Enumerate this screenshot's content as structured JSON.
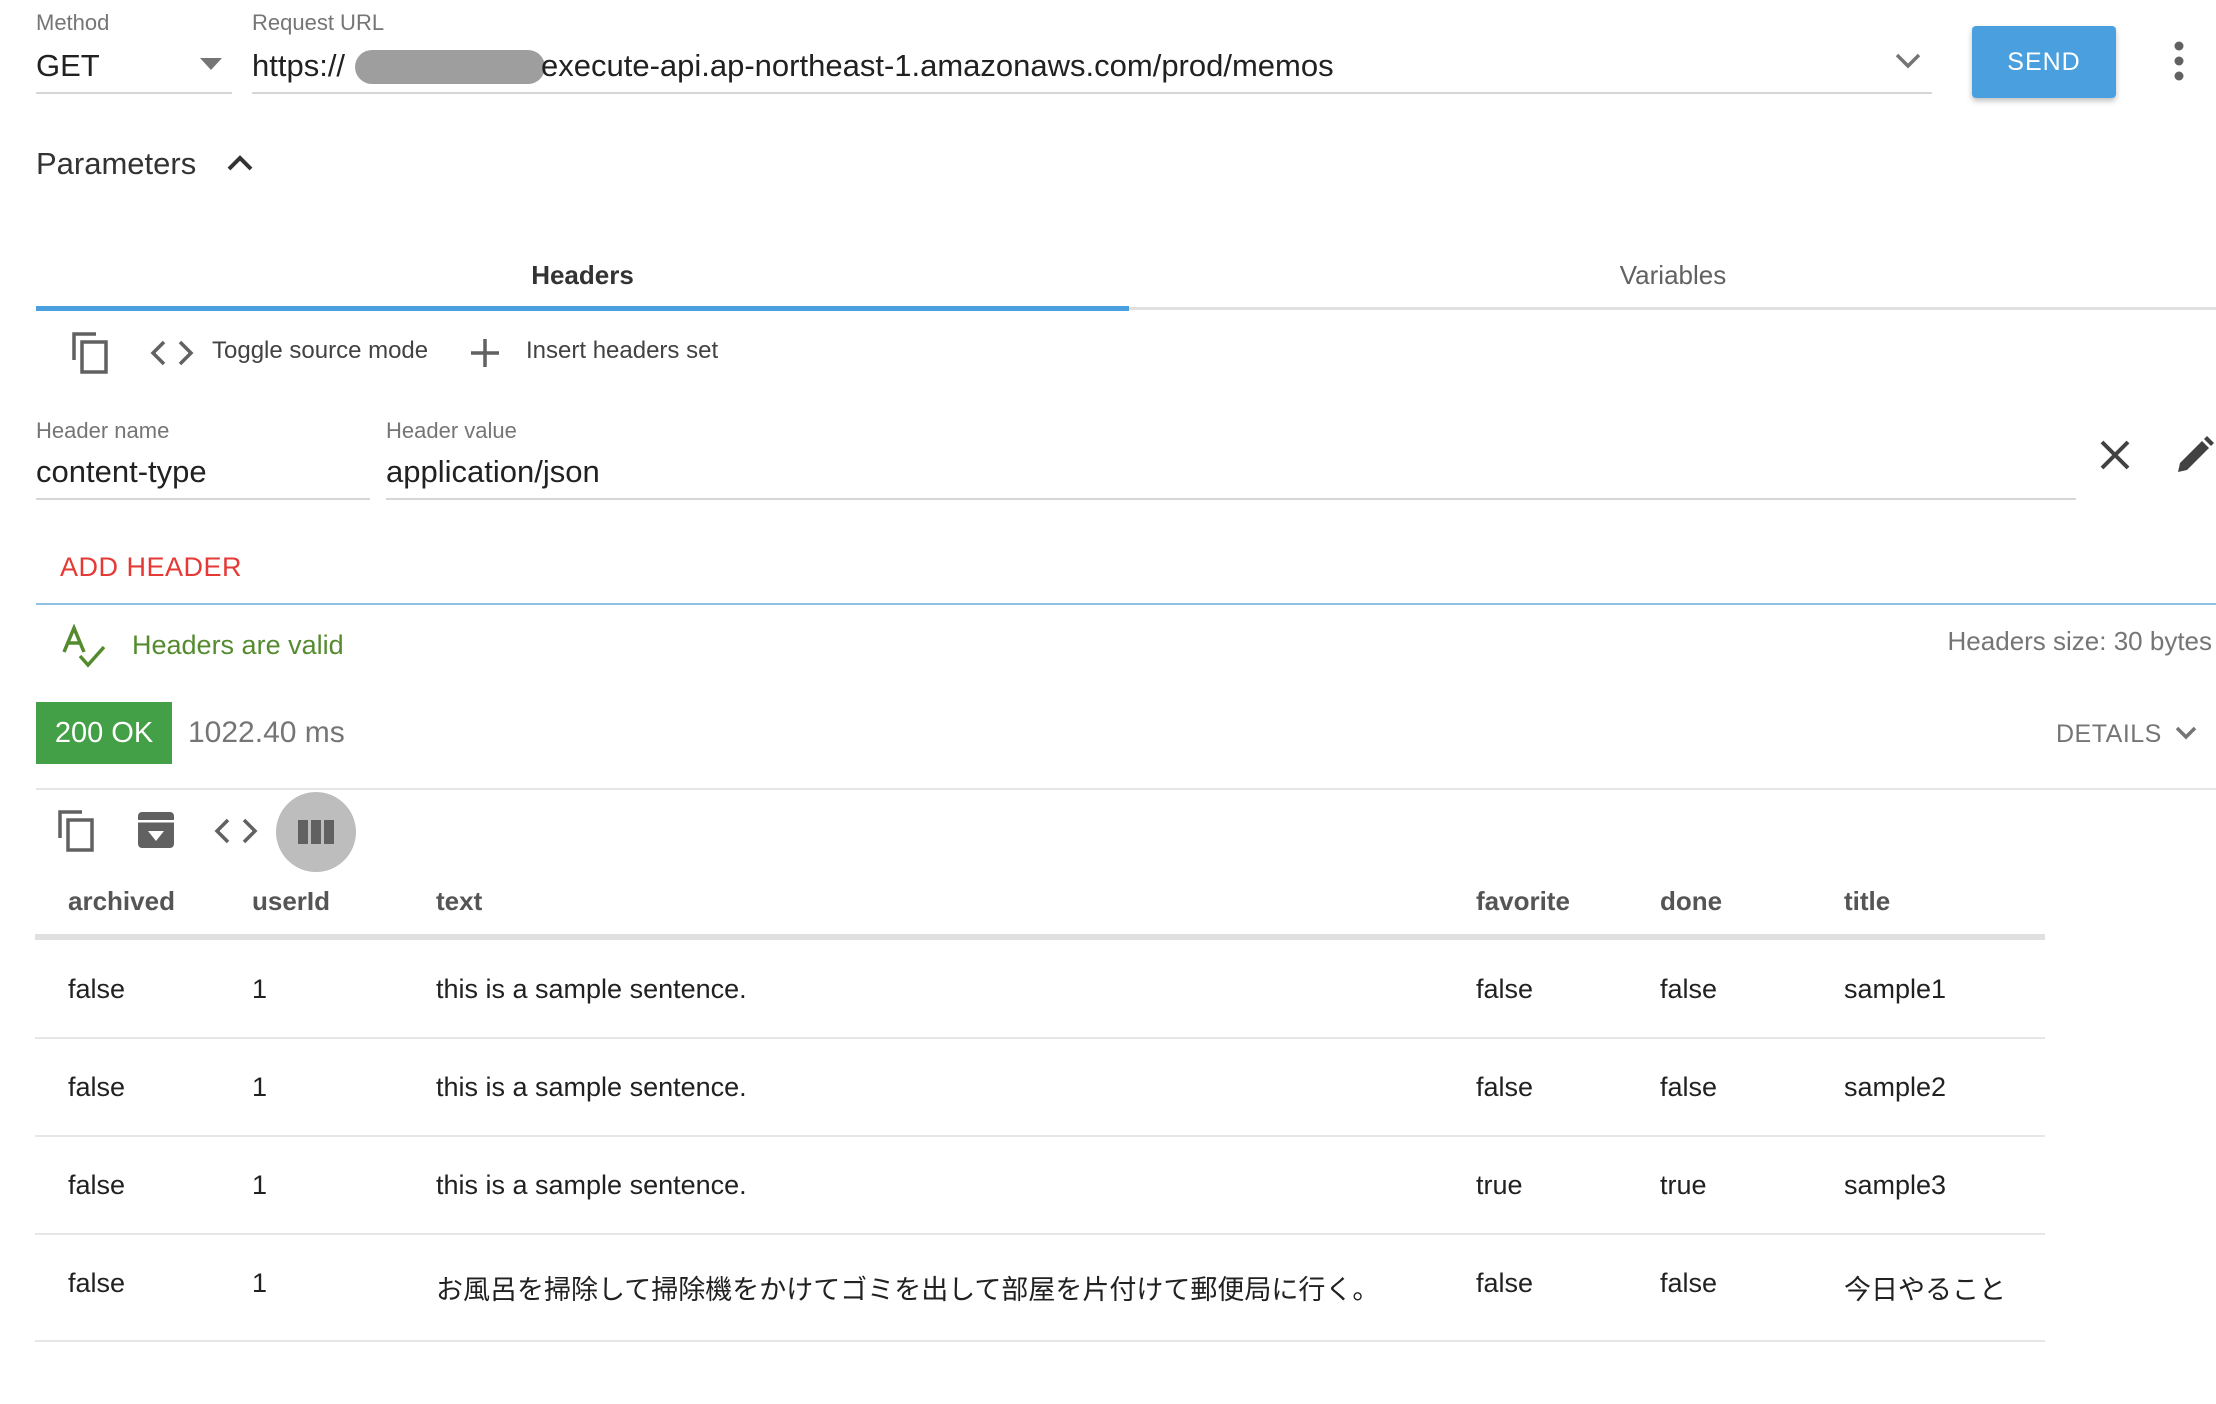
{
  "request": {
    "method_label": "Method",
    "method_value": "GET",
    "url_label": "Request URL",
    "url_prefix": "https://",
    "url_suffix": "execute-api.ap-northeast-1.amazonaws.com/prod/memos",
    "send_label": "SEND"
  },
  "parameters": {
    "title": "Parameters",
    "tabs": [
      {
        "label": "Headers",
        "active": true
      },
      {
        "label": "Variables",
        "active": false
      }
    ]
  },
  "headers_editor": {
    "toggle_source_label": "Toggle source mode",
    "insert_set_label": "Insert headers set",
    "name_label": "Header name",
    "value_label": "Header value",
    "rows": [
      {
        "name": "content-type",
        "value": "application/json"
      }
    ],
    "add_header_label": "ADD HEADER",
    "valid_text": "Headers are valid",
    "size_text": "Headers size: 30 bytes"
  },
  "response": {
    "status": "200 OK",
    "time": "1022.40 ms",
    "details_label": "DETAILS",
    "table": {
      "columns": [
        "archived",
        "userId",
        "text",
        "favorite",
        "done",
        "title"
      ],
      "rows": [
        [
          "false",
          "1",
          "this is a sample sentence.",
          "false",
          "false",
          "sample1"
        ],
        [
          "false",
          "1",
          "this is a sample sentence.",
          "false",
          "false",
          "sample2"
        ],
        [
          "false",
          "1",
          "this is a sample sentence.",
          "true",
          "true",
          "sample3"
        ],
        [
          "false",
          "1",
          "お風呂を掃除して掃除機をかけてゴミを出して部屋を片付けて郵便局に行く。",
          "false",
          "false",
          "今日やること"
        ]
      ]
    }
  },
  "colors": {
    "accent": "#4a9fdf",
    "success": "#43a047",
    "valid_text": "#558b2f",
    "add_header": "#e53935"
  },
  "icons": {
    "method_dropdown": "caret-down-icon",
    "url_dropdown": "chevron-down-icon",
    "menu": "more-vert-icon",
    "parameters_toggle": "chevron-up-icon",
    "copy": "copy-icon",
    "source": "code-icon",
    "insert": "plus-icon",
    "remove_header": "close-icon",
    "edit_header": "pencil-icon",
    "valid": "spellcheck-icon",
    "details": "chevron-down-icon",
    "save": "archive-download-icon",
    "table_view": "view-column-icon"
  }
}
